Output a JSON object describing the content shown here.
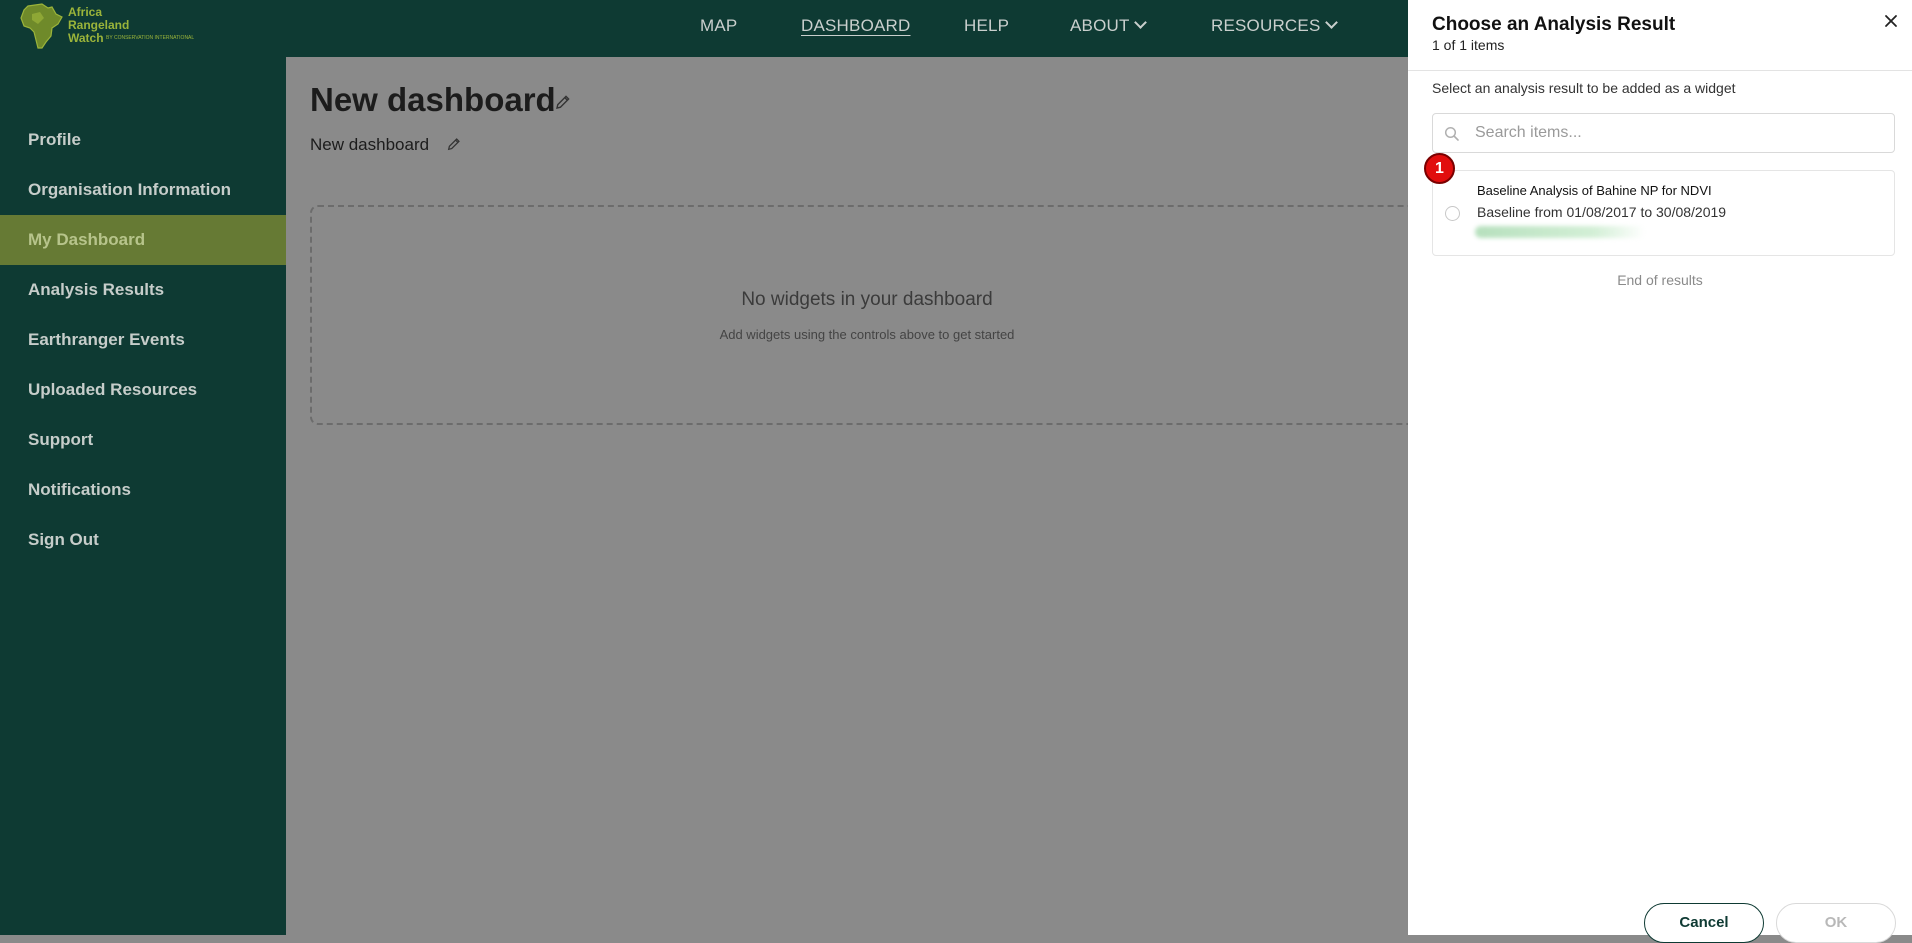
{
  "logo": {
    "line1": "Africa",
    "line2": "Rangeland",
    "line3": "Watch",
    "tagline": "BY CONSERVATION INTERNATIONAL"
  },
  "nav": {
    "map": "MAP",
    "dashboard": "DASHBOARD",
    "help": "HELP",
    "about": "ABOUT",
    "resources": "RESOURCES"
  },
  "sidebar": {
    "items": [
      {
        "label": "Profile"
      },
      {
        "label": "Organisation Information"
      },
      {
        "label": "My Dashboard"
      },
      {
        "label": "Analysis Results"
      },
      {
        "label": "Earthranger Events"
      },
      {
        "label": "Uploaded Resources"
      },
      {
        "label": "Support"
      },
      {
        "label": "Notifications"
      },
      {
        "label": "Sign Out"
      }
    ]
  },
  "main": {
    "title": "New dashboard",
    "subtitle": "New dashboard",
    "empty_title": "No widgets in your dashboard",
    "empty_sub": "Add widgets using the controls above to get started"
  },
  "panel": {
    "title": "Choose an Analysis Result",
    "count": "1 of 1 items",
    "hint": "Select an analysis result to be added as a widget",
    "search_placeholder": "Search items...",
    "results": [
      {
        "title": "Baseline Analysis of Bahine NP for NDVI",
        "subtitle": "Baseline from 01/08/2017 to 30/08/2019"
      }
    ],
    "marker": "1",
    "end_text": "End of results",
    "cancel_label": "Cancel",
    "ok_label": "OK"
  },
  "colors": {
    "brand_dark": "#0e3a33",
    "sidebar_active": "#667a34",
    "marker_red": "#e10d0d"
  }
}
